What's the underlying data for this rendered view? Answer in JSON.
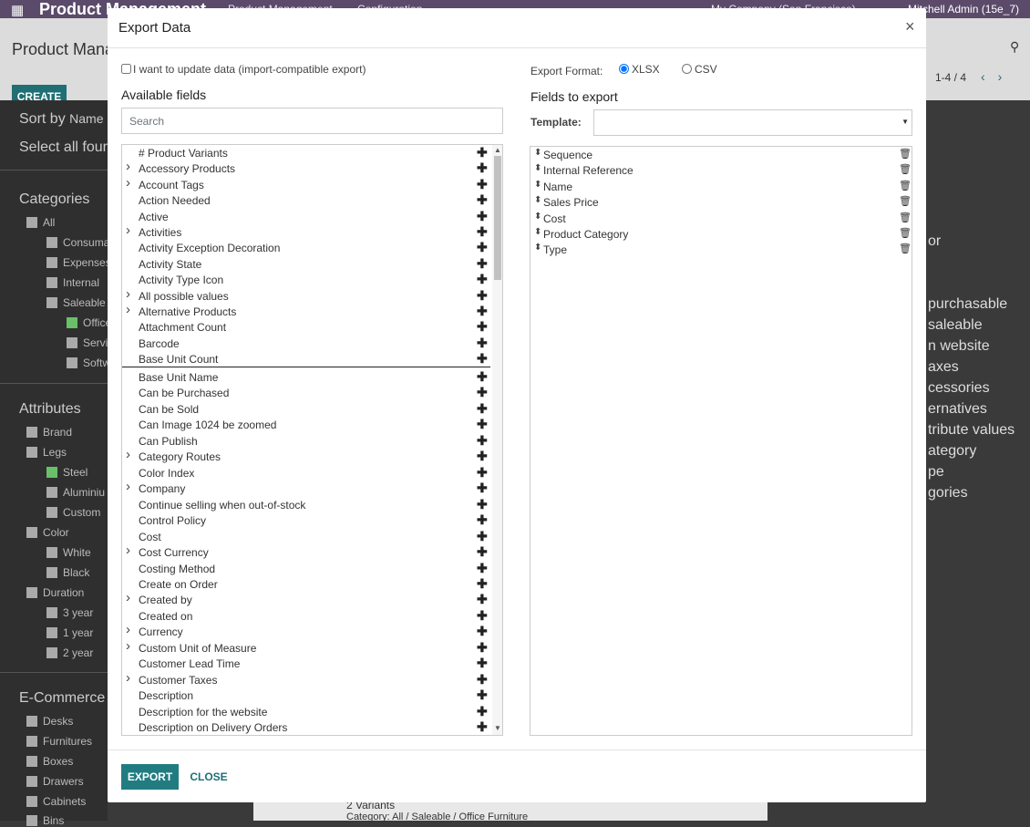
{
  "background": {
    "app_title": "Product Management",
    "menus": [
      "Product Management",
      "Configuration"
    ],
    "company": "My Company (San Francisco)",
    "user": "Mitchell Admin (15e_7)",
    "page_title": "Product Manag",
    "create_label": "CREATE",
    "pager": "1-4 / 4",
    "sort_by": "Sort by",
    "sort_value": "Name",
    "select_all": "Select all four",
    "categories_title": "Categories",
    "categories": [
      "All",
      "Consuma",
      "Expenses",
      "Internal",
      "Saleable",
      "Office",
      "Servic",
      "Softw"
    ],
    "attributes_title": "Attributes",
    "attributes": [
      "Brand",
      "Legs",
      "Steel",
      "Aluminiu",
      "Custom",
      "Color",
      "White",
      "Black",
      "Duration",
      "3 year",
      "1 year",
      "2 year"
    ],
    "ecommerce_title": "E-Commerce",
    "ecommerce": [
      "Desks",
      "Furnitures",
      "Boxes",
      "Drawers",
      "Cabinets",
      "Bins"
    ],
    "right_texts": [
      "or",
      "purchasable",
      "saleable",
      "n website",
      "axes",
      "cessories",
      "ernatives",
      "tribute values",
      "ategory",
      "pe",
      "gories"
    ],
    "bottom_text1": "2 Variants",
    "bottom_text2": "Category: All / Saleable / Office Furniture"
  },
  "modal": {
    "title": "Export Data",
    "close_icon": "×",
    "import_compat_label": "I want to update data (import-compatible export)",
    "available_title": "Available fields",
    "search_placeholder": "Search",
    "export_format_label": "Export Format:",
    "formats": [
      {
        "label": "XLSX",
        "checked": true
      },
      {
        "label": "CSV",
        "checked": false
      }
    ],
    "fields_to_export_title": "Fields to export",
    "template_label": "Template:",
    "template_value": "",
    "available_fields": [
      {
        "label": "# Product Variants",
        "expandable": false
      },
      {
        "label": "Accessory Products",
        "expandable": true
      },
      {
        "label": "Account Tags",
        "expandable": true
      },
      {
        "label": "Action Needed",
        "expandable": false
      },
      {
        "label": "Active",
        "expandable": false
      },
      {
        "label": "Activities",
        "expandable": true
      },
      {
        "label": "Activity Exception Decoration",
        "expandable": false
      },
      {
        "label": "Activity State",
        "expandable": false
      },
      {
        "label": "Activity Type Icon",
        "expandable": false
      },
      {
        "label": "All possible values",
        "expandable": true
      },
      {
        "label": "Alternative Products",
        "expandable": true
      },
      {
        "label": "Attachment Count",
        "expandable": false
      },
      {
        "label": "Barcode",
        "expandable": false
      },
      {
        "label": "Base Unit Count",
        "expandable": false,
        "selected": true
      },
      {
        "label": "Base Unit Name",
        "expandable": false
      },
      {
        "label": "Can be Purchased",
        "expandable": false
      },
      {
        "label": "Can be Sold",
        "expandable": false
      },
      {
        "label": "Can Image 1024 be zoomed",
        "expandable": false
      },
      {
        "label": "Can Publish",
        "expandable": false
      },
      {
        "label": "Category Routes",
        "expandable": true
      },
      {
        "label": "Color Index",
        "expandable": false
      },
      {
        "label": "Company",
        "expandable": true
      },
      {
        "label": "Continue selling when out-of-stock",
        "expandable": false
      },
      {
        "label": "Control Policy",
        "expandable": false
      },
      {
        "label": "Cost",
        "expandable": false
      },
      {
        "label": "Cost Currency",
        "expandable": true
      },
      {
        "label": "Costing Method",
        "expandable": false
      },
      {
        "label": "Create on Order",
        "expandable": false
      },
      {
        "label": "Created by",
        "expandable": true
      },
      {
        "label": "Created on",
        "expandable": false
      },
      {
        "label": "Currency",
        "expandable": true
      },
      {
        "label": "Custom Unit of Measure",
        "expandable": true
      },
      {
        "label": "Customer Lead Time",
        "expandable": false
      },
      {
        "label": "Customer Taxes",
        "expandable": true
      },
      {
        "label": "Description",
        "expandable": false
      },
      {
        "label": "Description for the website",
        "expandable": false
      },
      {
        "label": "Description on Delivery Orders",
        "expandable": false
      }
    ],
    "export_fields": [
      "Sequence",
      "Internal Reference",
      "Name",
      "Sales Price",
      "Cost",
      "Product Category",
      "Type"
    ],
    "export_button": "EXPORT",
    "close_button": "CLOSE"
  }
}
